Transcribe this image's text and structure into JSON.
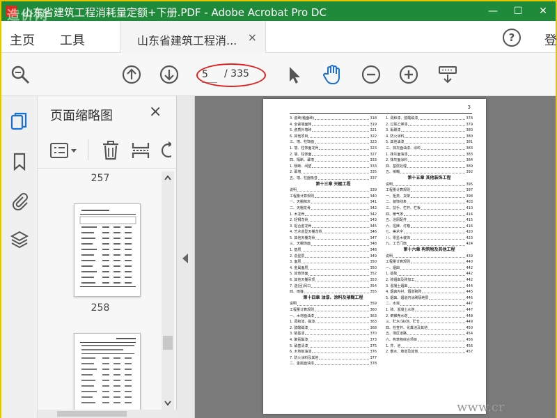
{
  "window": {
    "title": "山东省建筑工程消耗量定额+下册.PDF - Adobe Acrobat Pro DC",
    "minimize": "—",
    "maximize": "☐",
    "close": "✕"
  },
  "watermark_top": "造价网",
  "watermark_bottom": "www.cr",
  "menu": {
    "home": "主页",
    "tools": "工具",
    "tab_title": "山东省建筑工程消...",
    "tab_close": "×",
    "help": "?",
    "login": "登"
  },
  "toolbar": {
    "current_page": "5",
    "total_pages": "/ 335"
  },
  "thumbnail_panel": {
    "title": "页面缩略图",
    "close": "×",
    "labels": [
      "257",
      "258"
    ]
  },
  "toc": {
    "page_number": "3",
    "left_column": [
      {
        "t": "3. 瓷砖(釉面砖)",
        "n": "318"
      },
      {
        "t": "4. 全瓷墙面砖",
        "n": "319"
      },
      {
        "t": "5. 瓷质外墙砖",
        "n": "321"
      },
      {
        "t": "6. 其他项目",
        "n": "322"
      },
      {
        "t": "三、墙、柱饰面",
        "n": "323"
      },
      {
        "t": "1. 墙、柱饰面龙骨",
        "n": "323"
      },
      {
        "t": "2. 墙、柱饰面",
        "n": "327"
      },
      {
        "t": "四、隔断、幕墙",
        "n": "333"
      },
      {
        "t": "1. 隔断、间壁",
        "n": "333"
      },
      {
        "t": "2. 幕墙",
        "n": "335"
      },
      {
        "t": "五、墙、柱面吸音",
        "n": "337"
      },
      {
        "chap": "第十三章 天棚工程"
      },
      {
        "t": "说明",
        "n": "339"
      },
      {
        "t": "工程量计算规则",
        "n": "340"
      },
      {
        "t": "一、天棚抹灰",
        "n": "341"
      },
      {
        "t": "二、天棚龙骨",
        "n": "342"
      },
      {
        "t": "1. 木龙骨",
        "n": "342"
      },
      {
        "t": "2. 轻钢龙骨",
        "n": "343"
      },
      {
        "t": "3. 铝合金龙骨",
        "n": "345"
      },
      {
        "t": "4. 艺术造型天棚龙骨",
        "n": "346"
      },
      {
        "t": "5. 其他天棚龙骨",
        "n": "347"
      },
      {
        "t": "三、天棚饰面",
        "n": "348"
      },
      {
        "t": "1. 基层",
        "n": "348"
      },
      {
        "t": "2. 造型层",
        "n": "349"
      },
      {
        "t": "3. 面层",
        "n": "350"
      },
      {
        "t": "4. 金属面层",
        "n": "350"
      },
      {
        "t": "5. 其他饰面",
        "n": "352"
      },
      {
        "t": "6. 其他天棚吊顶",
        "n": "353"
      },
      {
        "t": "7. 送(回)风口",
        "n": "354"
      },
      {
        "t": "四、雨篷",
        "n": "355"
      },
      {
        "chap": "第十四章 油漆、涂料及裱糊工程"
      },
      {
        "t": "说明",
        "n": "359"
      },
      {
        "t": "工程量计算规则",
        "n": "360"
      },
      {
        "t": "一、木材面油漆",
        "n": "363"
      },
      {
        "t": "1. 调和漆、磁漆",
        "n": "363"
      },
      {
        "t": "2. 醇酸磁漆",
        "n": "368"
      },
      {
        "t": "3. 硝基漆",
        "n": "370"
      },
      {
        "t": "4. 聚氨酯漆",
        "n": "373"
      },
      {
        "t": "5. 硝基清漆",
        "n": "375"
      },
      {
        "t": "6. 木地板油漆",
        "n": "376"
      },
      {
        "t": "7. 防火涂料及其他",
        "n": "377"
      },
      {
        "t": "二、金属面油漆",
        "n": "378"
      }
    ],
    "right_column": [
      {
        "t": "1. 调和漆、醇酸磁漆",
        "n": "378"
      },
      {
        "t": "2. 过氯乙烯漆",
        "n": "379"
      },
      {
        "t": "3. 氟碳漆",
        "n": "380"
      },
      {
        "t": "4. 防火涂料",
        "n": "380"
      },
      {
        "t": "5. 其他油漆",
        "n": "381"
      },
      {
        "t": "三、抹灰面油漆、涂料",
        "n": "383"
      },
      {
        "t": "1. 抹灰面油漆",
        "n": "383"
      },
      {
        "t": "2. 抹灰面涂料",
        "n": "384"
      },
      {
        "t": "四、基层处理",
        "n": "389"
      },
      {
        "t": "五、裱糊",
        "n": "392"
      },
      {
        "chap": "第十五章 其他装饰工程"
      },
      {
        "t": "说明",
        "n": "395"
      },
      {
        "t": "工程量计算规则",
        "n": "397"
      },
      {
        "t": "一、柜类、货架",
        "n": "398"
      },
      {
        "t": "二、装饰线条",
        "n": "403"
      },
      {
        "t": "三、扶手、栏杆、栏板",
        "n": "410"
      },
      {
        "t": "四、暖气罩",
        "n": "414"
      },
      {
        "t": "五、浴厕配件",
        "n": "415"
      },
      {
        "t": "六、招牌、灯箱",
        "n": "416"
      },
      {
        "t": "七、美术字",
        "n": "420"
      },
      {
        "t": "八、零星木装饰",
        "n": "423"
      },
      {
        "t": "九、工艺门扇",
        "n": "424"
      },
      {
        "chap": "第十六章 构筑物及其他工程"
      },
      {
        "t": "说明",
        "n": "439"
      },
      {
        "t": "工程量计算规则",
        "n": "440"
      },
      {
        "t": "一、烟囱",
        "n": "442"
      },
      {
        "t": "1. 基础",
        "n": "442"
      },
      {
        "t": "2. 砖烟囱及砖加工",
        "n": "442"
      },
      {
        "t": "3. 混凝土烟囱",
        "n": "444"
      },
      {
        "t": "4. 烟囱内衬、烟道砌砖",
        "n": "445"
      },
      {
        "t": "5. 烟囱、烟道内涂刷隔绝层",
        "n": "446"
      },
      {
        "t": "二、水塔",
        "n": "447"
      },
      {
        "t": "1. 砖、混凝土水塔",
        "n": "447"
      },
      {
        "t": "2. 倒锥壳水塔",
        "n": "448"
      },
      {
        "t": "三、贮水(油)池、贮仓",
        "n": "449"
      },
      {
        "t": "四、检查井、化粪池及其他",
        "n": "450"
      },
      {
        "t": "五、场区道路",
        "n": "454"
      },
      {
        "t": "六、构筑物综合项目",
        "n": "456"
      },
      {
        "t": "1. 井、池",
        "n": "456"
      },
      {
        "t": "2. 散水、坡道及其他",
        "n": "457"
      }
    ]
  }
}
